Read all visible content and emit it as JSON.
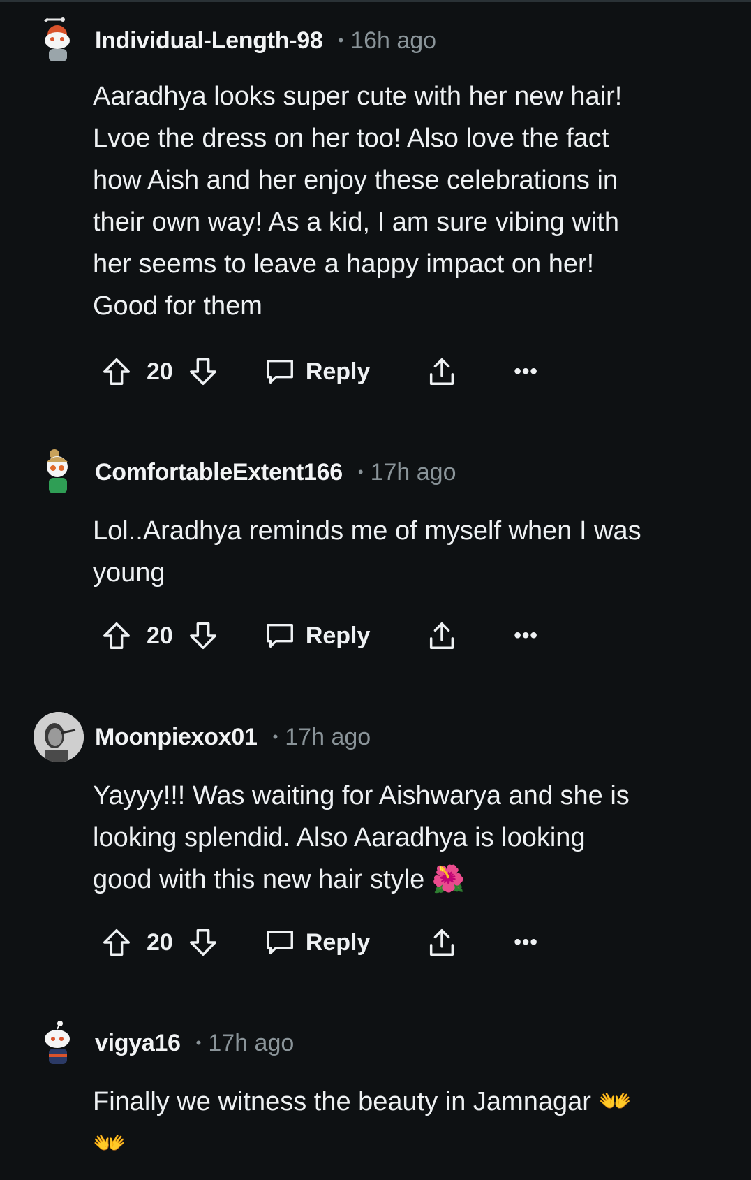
{
  "comments": [
    {
      "username": "Individual-Length-98",
      "separator": "•",
      "time": "16h ago",
      "body_lines": [
        "Aaradhya looks super cute with her new hair!",
        "Lvoe the dress on her too! Also love the fact",
        "how Aish and her enjoy these celebrations in",
        "their own way! As a kid, I am sure vibing with",
        "her seems to leave a happy impact on her!",
        "Good for them"
      ],
      "score": "20",
      "reply_label": "Reply",
      "more_label": "•••"
    },
    {
      "username": "ComfortableExtent166",
      "separator": "•",
      "time": "17h ago",
      "body_lines": [
        "Lol..Aradhya reminds me of myself when I was",
        "young"
      ],
      "score": "20",
      "reply_label": "Reply",
      "more_label": "•••"
    },
    {
      "username": "Moonpiexox01",
      "separator": "•",
      "time": "17h ago",
      "body_lines": [
        "Yayyy!!! Was waiting for Aishwarya and she is",
        "looking splendid. Also Aaradhya is looking",
        "good with this new hair style 🌺"
      ],
      "score": "20",
      "reply_label": "Reply",
      "more_label": "•••"
    },
    {
      "username": "vigya16",
      "separator": "•",
      "time": "17h ago",
      "body_lines": [
        "Finally we witness the beauty in Jamnagar 👐",
        "👐"
      ]
    }
  ],
  "colors": {
    "background": "#0e1113",
    "text": "#eef1f3",
    "meta": "#8a9499"
  }
}
